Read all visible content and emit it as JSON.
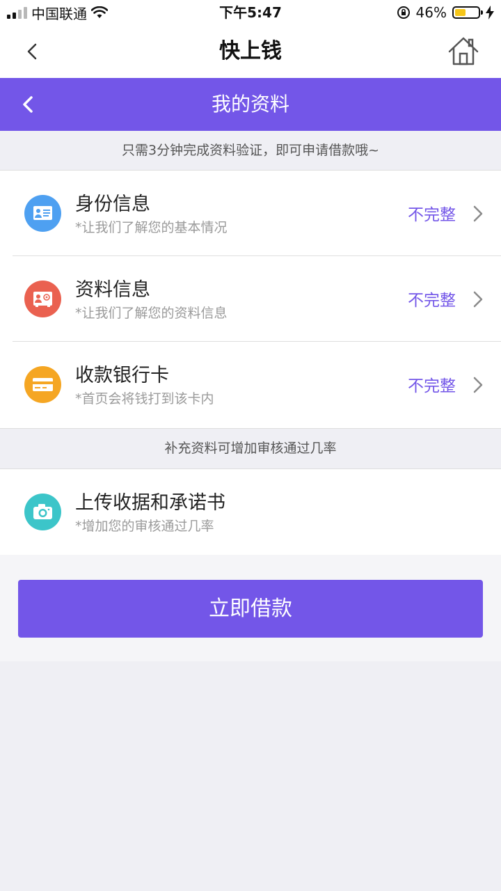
{
  "status_bar": {
    "carrier": "中国联通",
    "time": "下午5:47",
    "battery": "46%",
    "battery_level": 0.46
  },
  "nav": {
    "title": "快上钱",
    "back_icon": "chevron-left-icon",
    "home_icon": "home-icon"
  },
  "header": {
    "title": "我的资料",
    "back_icon": "chevron-left-icon"
  },
  "notice": "只需3分钟完成资料验证，即可申请借款哦~",
  "items": [
    {
      "title": "身份信息",
      "subtitle": "*让我们了解您的基本情况",
      "status": "不完整",
      "icon": "id-card-icon",
      "color": "#4ea0f1"
    },
    {
      "title": "资料信息",
      "subtitle": "*让我们了解您的资料信息",
      "status": "不完整",
      "icon": "profile-card-icon",
      "color": "#ea6150"
    },
    {
      "title": "收款银行卡",
      "subtitle": "*首页会将钱打到该卡内",
      "status": "不完整",
      "icon": "bank-card-icon",
      "color": "#f5a623"
    }
  ],
  "section_note": "补充资料可增加审核通过几率",
  "upload": {
    "title": "上传收据和承诺书",
    "subtitle": "*增加您的审核通过几率",
    "icon": "camera-icon",
    "color": "#3cc5c9"
  },
  "cta": {
    "label": "立即借款",
    "color": "#7356e8"
  }
}
